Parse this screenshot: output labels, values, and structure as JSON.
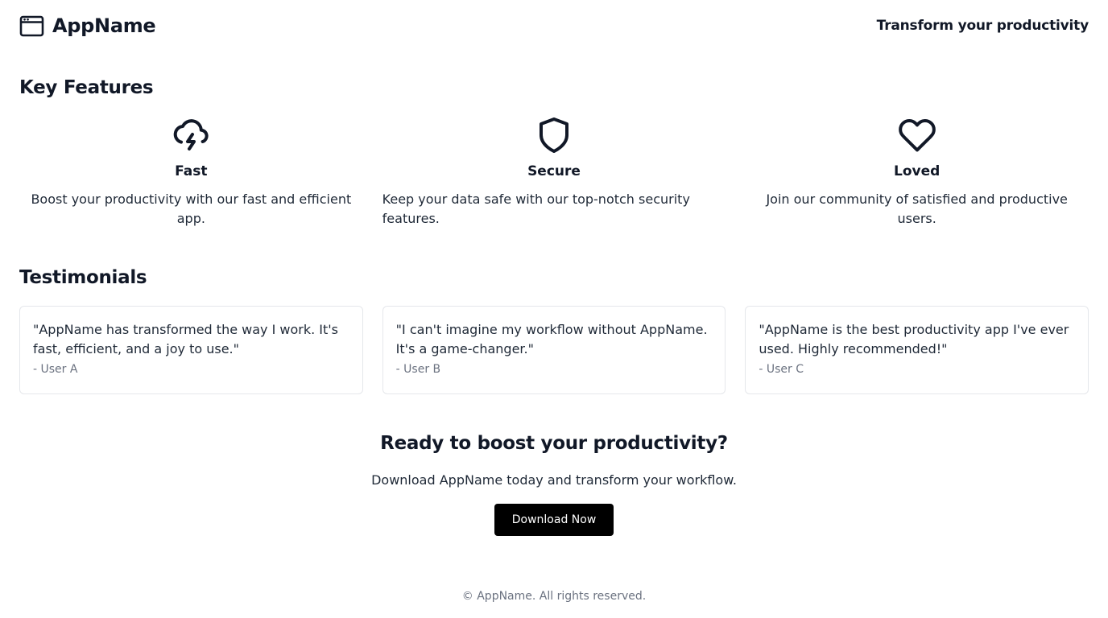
{
  "header": {
    "brand_name": "AppName",
    "brand_icon": "app-window-icon",
    "tagline": "Transform your productivity"
  },
  "features": {
    "title": "Key Features",
    "items": [
      {
        "icon": "cloud-lightning-icon",
        "title": "Fast",
        "description": "Boost your productivity with our fast and efficient app."
      },
      {
        "icon": "shield-icon",
        "title": "Secure",
        "description": "Keep your data safe with our top-notch security features."
      },
      {
        "icon": "heart-icon",
        "title": "Loved",
        "description": "Join our community of satisfied and productive users."
      }
    ]
  },
  "testimonials": {
    "title": "Testimonials",
    "items": [
      {
        "quote": "\"AppName has transformed the way I work. It's fast, efficient, and a joy to use.\"",
        "author": "- User A"
      },
      {
        "quote": "\"I can't imagine my workflow without AppName. It's a game-changer.\"",
        "author": "- User B"
      },
      {
        "quote": "\"AppName is the best productivity app I've ever used. Highly recommended!\"",
        "author": "- User C"
      }
    ]
  },
  "cta": {
    "title": "Ready to boost your productivity?",
    "text": "Download AppName today and transform your workflow.",
    "button_label": "Download Now"
  },
  "footer": {
    "text": "© AppName. All rights reserved."
  },
  "colors": {
    "text": "#111827",
    "muted": "#6b7280",
    "border": "#e5e7eb",
    "button_bg": "#000000",
    "button_text": "#ffffff"
  }
}
